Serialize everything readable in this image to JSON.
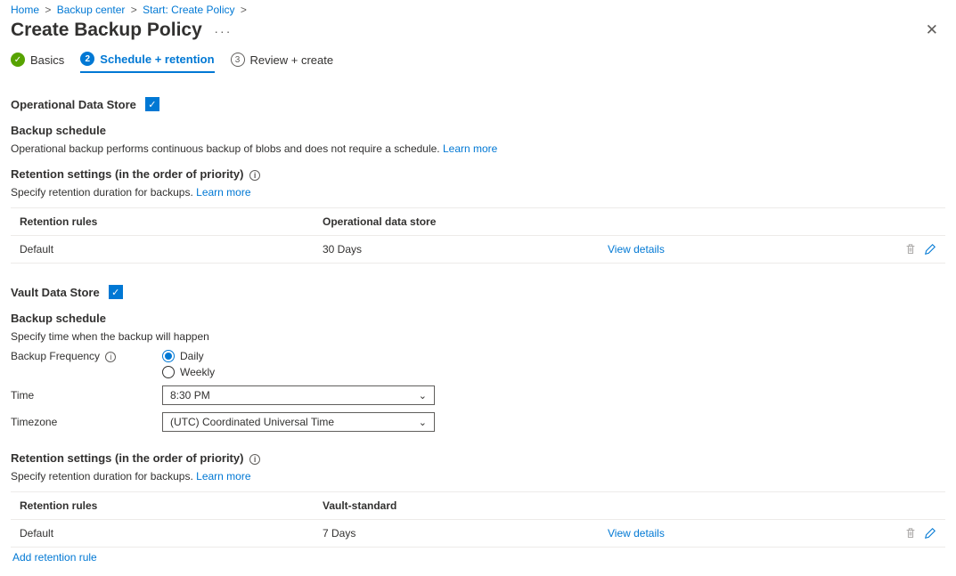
{
  "breadcrumb": {
    "home": "Home",
    "center": "Backup center",
    "start": "Start: Create Policy"
  },
  "page": {
    "title": "Create Backup Policy"
  },
  "tabs": {
    "basics": "Basics",
    "schedule": "Schedule + retention",
    "review": "Review + create"
  },
  "ods": {
    "title": "Operational Data Store",
    "schedule_head": "Backup schedule",
    "schedule_desc": "Operational backup performs continuous backup of blobs and does not require a schedule.",
    "learn_more": "Learn more",
    "retention_head": "Retention settings (in the order of priority)",
    "retention_desc": "Specify retention duration for backups.",
    "col_rules": "Retention rules",
    "col_store": "Operational data store",
    "row_rule": "Default",
    "row_store": "30 Days",
    "view_details": "View details"
  },
  "vds": {
    "title": "Vault Data Store",
    "schedule_head": "Backup schedule",
    "schedule_desc": "Specify time when the backup will happen",
    "freq_label": "Backup Frequency",
    "daily": "Daily",
    "weekly": "Weekly",
    "time_label": "Time",
    "time_value": "8:30 PM",
    "tz_label": "Timezone",
    "tz_value": "(UTC) Coordinated Universal Time",
    "retention_head": "Retention settings (in the order of priority)",
    "retention_desc": "Specify retention duration for backups.",
    "learn_more": "Learn more",
    "col_rules": "Retention rules",
    "col_store": "Vault-standard",
    "row_rule": "Default",
    "row_store": "7 Days",
    "view_details": "View details",
    "add_rule": "Add retention rule"
  }
}
